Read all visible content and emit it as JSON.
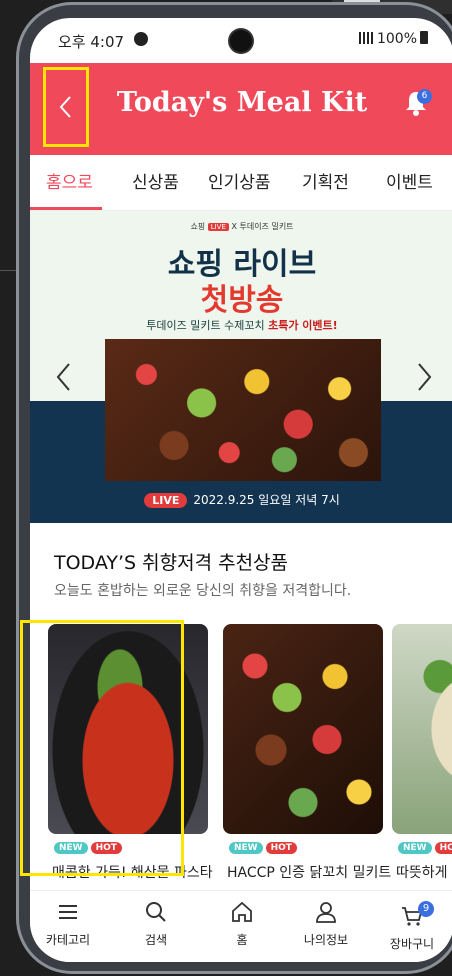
{
  "status_bar": {
    "time": "오후 4:07",
    "battery": "100%"
  },
  "header": {
    "title": "Today's Meal Kit",
    "notification_count": "6",
    "accent_color": "#f0495a"
  },
  "tabs": [
    {
      "label": "홈으로",
      "active": true
    },
    {
      "label": "신상품",
      "active": false
    },
    {
      "label": "인기상품",
      "active": false
    },
    {
      "label": "기획전",
      "active": false
    },
    {
      "label": "이벤트",
      "active": false
    }
  ],
  "banner": {
    "tag_left": "쇼핑",
    "tag_live": "LIVE",
    "tag_right": "X 투데이즈 밀키트",
    "title_line1": "쇼핑 라이브",
    "title_line2": "첫방송",
    "subtitle_normal": "투데이즈 밀키트 수제꼬치",
    "subtitle_bold": "초특가 이벤트!",
    "live_label": "LIVE",
    "date_text": "2022.9.25 일요일 저녁 7시"
  },
  "section": {
    "title": "TODAY’S 취향저격 추천상품",
    "subtitle": "오늘도 혼밥하는 외로운 당신의 취향을 저격합니다."
  },
  "products": [
    {
      "name": "매콤한 가득! 해산물 파스타",
      "badge_new": "NEW",
      "badge_hot": "HOT"
    },
    {
      "name": "HACCP 인증 닭꼬치 밀키트",
      "badge_new": "NEW",
      "badge_hot": "HOT"
    },
    {
      "name": "따뜻하게",
      "badge_new": "NEW",
      "badge_hot": "HOT"
    }
  ],
  "bottom_nav": [
    {
      "label": "카테고리",
      "icon": "menu-icon"
    },
    {
      "label": "검색",
      "icon": "search-icon"
    },
    {
      "label": "홈",
      "icon": "home-icon"
    },
    {
      "label": "나의정보",
      "icon": "user-icon"
    },
    {
      "label": "장바구니",
      "icon": "cart-icon"
    }
  ],
  "cart_count": "9"
}
